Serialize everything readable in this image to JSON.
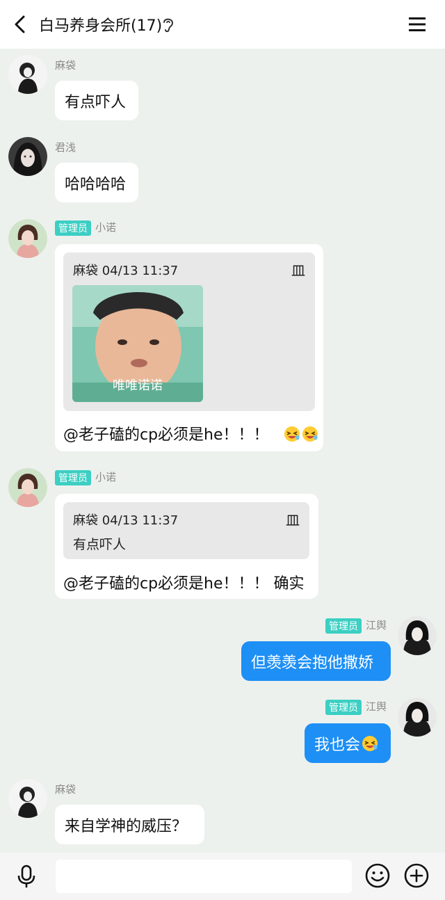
{
  "header": {
    "title": "白马养身会所(17)"
  },
  "messages": [
    {
      "sender": "麻袋",
      "text": "有点吓人"
    },
    {
      "sender": "君浅",
      "text": "哈哈哈哈"
    },
    {
      "badge": "管理员",
      "sender": "小诺",
      "quote_meta": "麻袋 04/13 11:37",
      "quote_pin": "⽫",
      "sticker_caption": "唯唯诺诺",
      "text": "@老子磕的cp必须是he！！！"
    },
    {
      "badge": "管理员",
      "sender": "小诺",
      "quote_meta": "麻袋 04/13 11:37",
      "quote_pin": "⽫",
      "quote_text": "有点吓人",
      "text": "@老子磕的cp必须是he！！！ 确实"
    },
    {
      "badge": "管理员",
      "sender": "江舆",
      "text": "但羡羡会抱他撒娇"
    },
    {
      "badge": "管理员",
      "sender": "江舆",
      "text": "我也会"
    },
    {
      "sender": "麻袋",
      "text": "来自学神的威压？"
    }
  ],
  "colors": {
    "background": "#edf1ee",
    "admin_badge": "#3ccfc3",
    "my_bubble": "#1e8ff5"
  },
  "icons": [
    "back-arrow-icon",
    "ear-icon",
    "menu-icon",
    "microphone-icon",
    "smile-icon",
    "plus-icon",
    "laughing-emoji-icon"
  ]
}
